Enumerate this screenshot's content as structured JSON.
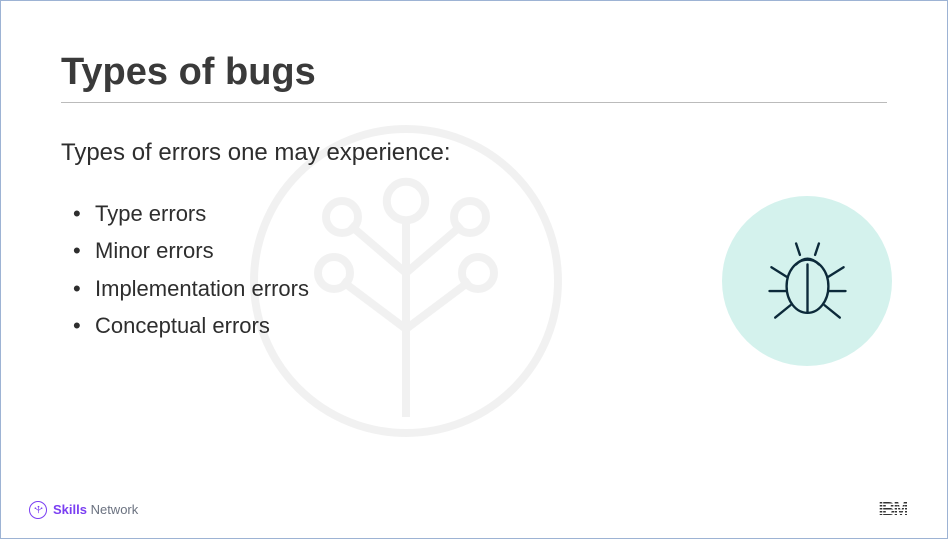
{
  "title": "Types of bugs",
  "subtitle": "Types of errors one may experience:",
  "bullets": [
    "Type errors",
    "Minor errors",
    "Implementation errors",
    "Conceptual errors"
  ],
  "footer": {
    "skills_bold": "Skills",
    "skills_regular": " Network",
    "ibm": "IBM"
  }
}
